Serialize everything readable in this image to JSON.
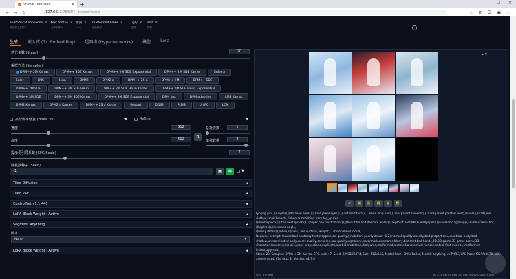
{
  "browser": {
    "tab_title": "Stable Diffusion",
    "url_host": "127.0.0.1",
    "url_rest": ":7860/?__theme=dark"
  },
  "prompt_tabs": [
    {
      "label": "anatomical nonsense",
      "sub": "解剖学上无意义"
    },
    {
      "label": "text font ui",
      "sub": "文本字体ui"
    },
    {
      "label": "错误",
      "sub": "error"
    },
    {
      "label": "malformed limbs",
      "sub": "四肢畸形"
    },
    {
      "label": "ugly",
      "sub": "丑陋"
    },
    {
      "label": "shit",
      "sub": "狗屎"
    }
  ],
  "main_tabs": [
    "生成",
    "嵌入式 (T.I. Embedding)",
    "超网络 (Hypernetworks)",
    "模型",
    "Lora"
  ],
  "steps": {
    "label": "迭代步数 (Steps)",
    "value": "20"
  },
  "sampler": {
    "label": "采样方法 (Sampler)",
    "options": [
      "DPM++ 2M Karras",
      "DPM++ SDE Karras",
      "DPM++ 2M SDE Exponential",
      "DPM++ 2M SDE Karras",
      "Euler a",
      "Euler",
      "LMS",
      "Heun",
      "DPM2",
      "DPM2 a",
      "DPM++ 2S a",
      "DPM++ 2M",
      "DPM++ SDE",
      "DPM++ 2M SDE",
      "DPM++ 2M SDE Heun",
      "DPM++ 2M SDE Heun Karras",
      "DPM++ 2M SDE Heun Exponential",
      "DPM++ 3M SDE",
      "DPM++ 3M SDE Karras",
      "DPM++ 3M SDE Exponential",
      "DPM fast",
      "DPM adaptive",
      "LMS Karras",
      "DPM2 Karras",
      "DPM2 a Karras",
      "DPM++ 2S a Karras",
      "Restart",
      "DDIM",
      "PLMS",
      "UniPC",
      "LCM"
    ],
    "selected": "DPM++ 2M Karras"
  },
  "hires": {
    "label": "高分辨率修复 (Hires. fix)"
  },
  "refiner": {
    "label": "Refiner"
  },
  "width": {
    "label": "宽度",
    "value": "512"
  },
  "height": {
    "label": "高度",
    "value": "512"
  },
  "batch_count": {
    "label": "总批次数",
    "value": "1"
  },
  "batch_size": {
    "label": "单批数量",
    "value": "8"
  },
  "cfg": {
    "label": "提示词引导系数 (CFG Scale)",
    "value": "7"
  },
  "seed": {
    "label": "随机数种子 (Seed)",
    "value": "-1"
  },
  "accordions": [
    "Tiled Diffusion",
    "Tiled VAE",
    "ControlNet v1.1.440",
    "LoRA Block Weight : Active",
    "Segment Anything"
  ],
  "script": {
    "label": "脚本",
    "value": "None"
  },
  "lora_block_bottom": "LoRA Block Weight : Active",
  "info_text": [
    "(young girl),((nipple)),((detailed eyes)),((Blue jewel eyes)),(( detailed face )),( white long hair),(Transparent raincoat),( Transparent pleated skirt),(navel)),(Calf),wet",
    "clothes,small breasts,ribbon,armsbehind back,leg_garter,",
    "((masterpiece)),((the best quality)),((super fine illustrations)),((beautiful and delicate water)),Depth of field,8KCG wallpapers,((cinematic lighting)),anime screenshot,",
    "((highres)),cinematic angle,",
    "((many Petals)),reflex,ripples,Lake surface,Twilight,Cumulonimbus cloud,",
    "Negative prompt: lowres,bad anatomy,text,cropped,low quality,(mutation, poorly drawn :1.2),normal quality,obesity,bad proportions,unnatural body,bad",
    "shadow,uncoordinated body,worst quality,censored,low quality,signature,watermark,username,blurry,bad feet,bad hands,3D,3D game,3D game scene,3D",
    "character,censored,mosaic,gross proportions,duplicate,morbid,mutilated,disfigured,malformed,mutated,anatomical nonsense,text font ui,error,(malformed",
    "limbs),ugly,shit,",
    "Steps: 20, Sampler: DPM++ 2M Karras, CFG scale: 7, Seed: 3293122374, Size: 512x512, Model hash: 7f96a1a9ca, Model: anything-v5-PrtRE, VAE hash: f921fb3670, VAE:",
    "animevae.pt, Clip skip: 2, Version: v1.7.0"
  ],
  "footer_left": "用时: 1 m 4.6s",
  "footer_right": "A: 3.38 GB, R: 3.84 GB, Sys: 5.4/12.0 GB (45.0%)",
  "colors": {
    "accent": "#f97316",
    "bg": "#0b0f19",
    "panel": "#111827"
  }
}
